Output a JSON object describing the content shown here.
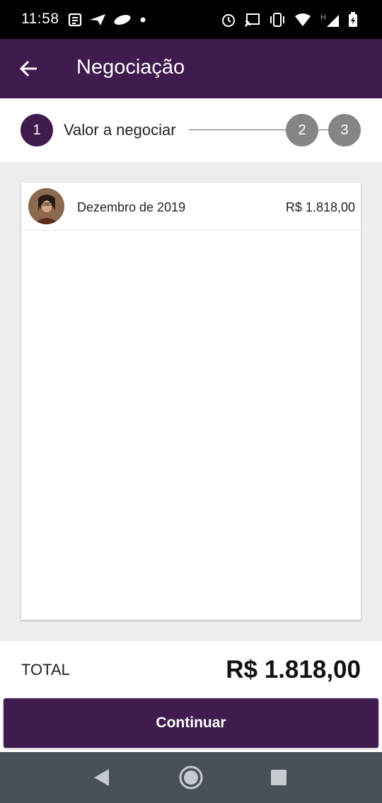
{
  "status_bar": {
    "time": "11:58",
    "left_icons": [
      "news-icon",
      "send-icon",
      "app-badge-icon",
      "dot-icon"
    ],
    "right_icons": [
      "alarm-icon",
      "cast-icon",
      "vibrate-icon",
      "wifi-icon",
      "signal-h-icon",
      "battery-icon"
    ]
  },
  "app_bar": {
    "title": "Negociação",
    "background": "#3f1b4e"
  },
  "stepper": {
    "steps": [
      {
        "number": "1",
        "label": "Valor a negociar",
        "active": true
      },
      {
        "number": "2",
        "active": false
      },
      {
        "number": "3",
        "active": false
      }
    ],
    "active_color": "#3f1b4e",
    "inactive_color": "#858585"
  },
  "list": {
    "items": [
      {
        "avatar": "person-avatar",
        "month": "Dezembro de 2019",
        "value": "R$ 1.818,00"
      }
    ]
  },
  "footer": {
    "total_label": "TOTAL",
    "total_value": "R$ 1.818,00",
    "continue_label": "Continuar"
  },
  "nav_bar": {
    "buttons": [
      "back-triangle-icon",
      "home-circle-icon",
      "recents-square-icon"
    ]
  }
}
